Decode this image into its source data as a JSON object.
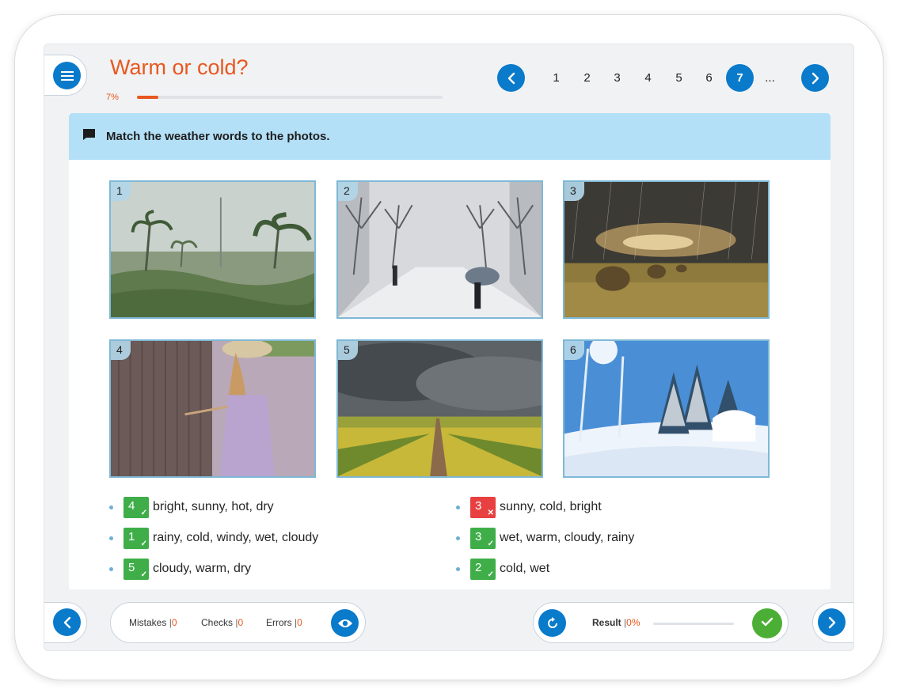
{
  "header": {
    "title": "Warm or cold?",
    "progress_label": "7%",
    "progress_fraction": 0.07
  },
  "pager": {
    "pages": [
      "1",
      "2",
      "3",
      "4",
      "5",
      "6",
      "7",
      "..."
    ],
    "active_page": "7"
  },
  "instruction": {
    "text": "Match the weather words to the photos.",
    "icon": "speech-bubble-icon"
  },
  "photos": [
    {
      "number": "1",
      "scene": "windy-rainy-palms"
    },
    {
      "number": "2",
      "scene": "snowy-park"
    },
    {
      "number": "3",
      "scene": "stormy-rain-field"
    },
    {
      "number": "4",
      "scene": "girl-sunny-fence"
    },
    {
      "number": "5",
      "scene": "cloudy-field"
    },
    {
      "number": "6",
      "scene": "sunny-snow-forest"
    }
  ],
  "answers": [
    {
      "badge": "4",
      "status": "correct",
      "words": "bright, sunny, hot, dry"
    },
    {
      "badge": "1",
      "status": "correct",
      "words": "rainy, cold, windy, wet, cloudy"
    },
    {
      "badge": "5",
      "status": "correct",
      "words": "cloudy, warm, dry"
    },
    {
      "badge": "3",
      "status": "incorrect",
      "words": "sunny, cold, bright"
    },
    {
      "badge": "3",
      "status": "correct",
      "words": "wet, warm, cloudy, rainy"
    },
    {
      "badge": "2",
      "status": "correct",
      "words": "cold, wet"
    }
  ],
  "footer": {
    "mistakes_label": "Mistakes",
    "mistakes_value": "0",
    "checks_label": "Checks",
    "checks_value": "0",
    "errors_label": "Errors",
    "errors_value": "0",
    "result_label": "Result",
    "result_value": "0%",
    "separator": "|"
  },
  "icons": {
    "menu": "hamburger-menu-icon",
    "prev": "chevron-left-icon",
    "next": "chevron-right-icon",
    "eye": "eye-icon",
    "reset": "refresh-icon",
    "check": "check-icon"
  },
  "colors": {
    "accent_blue": "#0a7acb",
    "title_orange": "#e8571e",
    "instruction_bg": "#b3e0f7",
    "correct_green": "#3fae49",
    "incorrect_red": "#e84040",
    "check_green": "#4caf35"
  }
}
